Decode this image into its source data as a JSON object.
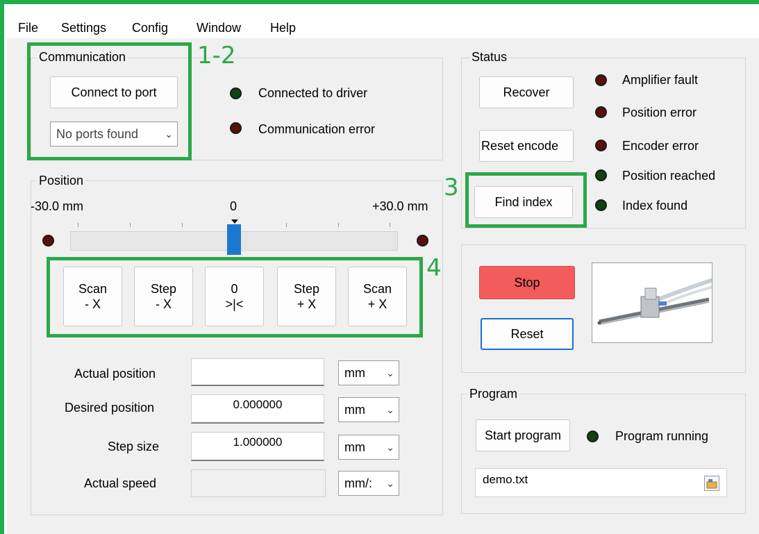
{
  "menu": [
    "File",
    "Settings",
    "Config",
    "Window",
    "Help"
  ],
  "communication": {
    "title": "Communication",
    "connect_button": "Connect to port",
    "port_select": "No ports found",
    "indicators": [
      {
        "label": "Connected to driver",
        "state": "green"
      },
      {
        "label": "Communication error",
        "state": "red"
      }
    ]
  },
  "status": {
    "title": "Status",
    "recover_button": "Recover",
    "reset_encoder_button": "Reset encode",
    "find_index_button": "Find index",
    "indicators": [
      {
        "label": "Amplifier fault",
        "state": "red"
      },
      {
        "label": "Position error",
        "state": "red"
      },
      {
        "label": "Encoder error",
        "state": "red"
      },
      {
        "label": "Position reached",
        "state": "green"
      },
      {
        "label": "Index found",
        "state": "green"
      }
    ]
  },
  "position": {
    "title": "Position",
    "min_label": "-30.0 mm",
    "center_label": "0",
    "max_label": "+30.0 mm",
    "slider_value_fraction": 0.5,
    "buttons": [
      {
        "line1": "Scan",
        "line2": "- X"
      },
      {
        "line1": "Step",
        "line2": "- X"
      },
      {
        "line1": "0",
        "line2": ">|<"
      },
      {
        "line1": "Step",
        "line2": "+ X"
      },
      {
        "line1": "Scan",
        "line2": "+ X"
      }
    ],
    "fields": [
      {
        "label": "Actual position",
        "value": "",
        "unit": "mm"
      },
      {
        "label": "Desired position",
        "value": "0.000000",
        "unit": "mm"
      },
      {
        "label": "Step size",
        "value": "1.000000",
        "unit": "mm"
      },
      {
        "label": "Actual speed",
        "value": "",
        "unit": "mm/:"
      }
    ]
  },
  "control": {
    "stop_button": "Stop",
    "reset_button": "Reset"
  },
  "program": {
    "title": "Program",
    "start_button": "Start program",
    "running_label": "Program running",
    "file_value": "demo.txt"
  },
  "annotations": [
    "1-2",
    "3",
    "4"
  ],
  "colors": {
    "highlight": "#2ca84a",
    "stop": "#f25c5c",
    "led_red": "#5c0d0d",
    "led_green": "#0c4412",
    "slider_thumb": "#1b78d0"
  }
}
